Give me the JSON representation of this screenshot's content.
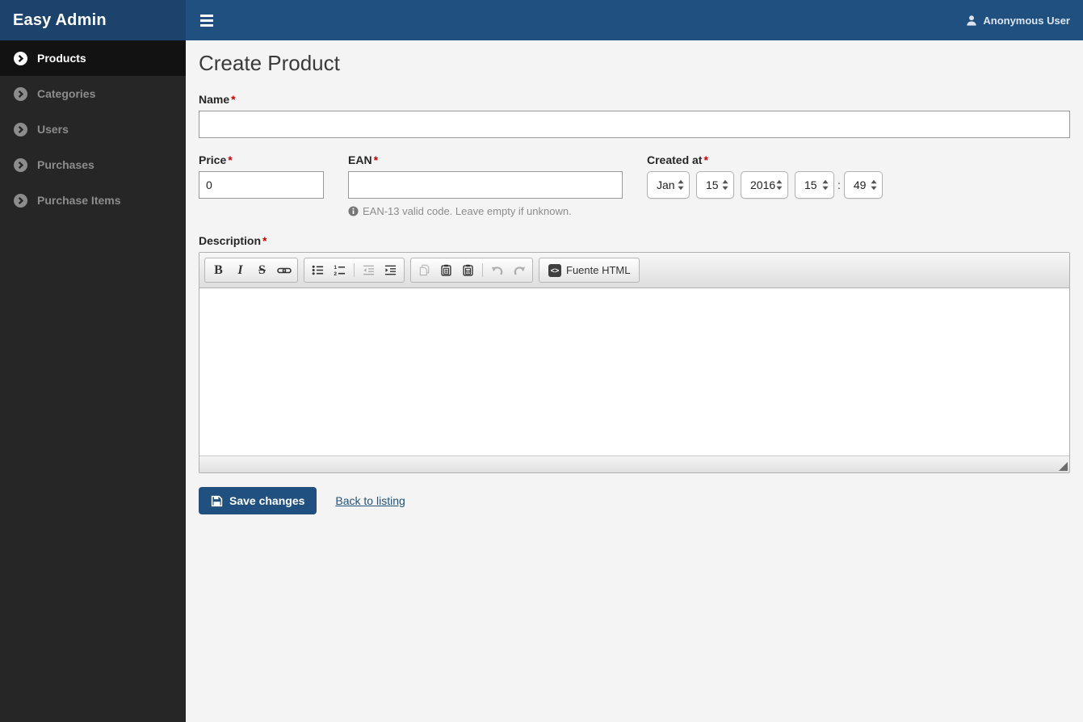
{
  "colors": {
    "brand_bg": "#1c436c",
    "topbar_bg": "#20507f",
    "sidebar_bg": "#262626",
    "sidebar_active_bg": "#121212",
    "primary_button_bg": "#20507f",
    "link_color": "#23527c",
    "required_asterisk": "#cc0000"
  },
  "app": {
    "brand": "Easy Admin",
    "user_name": "Anonymous User"
  },
  "sidebar": {
    "items": [
      {
        "label": "Products",
        "active": true
      },
      {
        "label": "Categories",
        "active": false
      },
      {
        "label": "Users",
        "active": false
      },
      {
        "label": "Purchases",
        "active": false
      },
      {
        "label": "Purchase Items",
        "active": false
      }
    ]
  },
  "page": {
    "title": "Create Product"
  },
  "form": {
    "required_mark": "*",
    "name": {
      "label": "Name",
      "value": ""
    },
    "price": {
      "label": "Price",
      "value": "0"
    },
    "ean": {
      "label": "EAN",
      "value": "",
      "help": "EAN-13 valid code. Leave empty if unknown."
    },
    "created_at": {
      "label": "Created at",
      "month": "Jan",
      "day": "15",
      "year": "2016",
      "hour": "15",
      "time_separator": ":",
      "minute": "49"
    },
    "description": {
      "label": "Description",
      "value": ""
    }
  },
  "editor": {
    "toolbar": {
      "bold_glyph": "B",
      "italic_glyph": "I",
      "strike_glyph": "S",
      "source_glyph": "<>",
      "source_label": "Fuente HTML"
    }
  },
  "actions": {
    "save_label": "Save changes",
    "back_label": "Back to listing"
  }
}
